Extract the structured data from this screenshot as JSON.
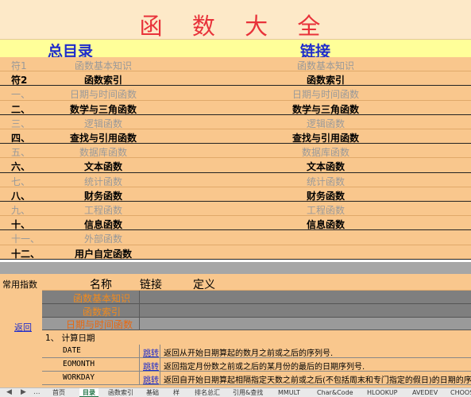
{
  "title": "函 数 大 全",
  "header": {
    "left": "总目录",
    "right": "链接"
  },
  "toc": [
    {
      "num": "符1",
      "label": "函数基本知识",
      "link": "函数基本知识",
      "style": "g"
    },
    {
      "num": "符2",
      "label": "函数索引",
      "link": "函数索引",
      "style": "b"
    },
    {
      "num": "一、",
      "label": "日期与时间函数",
      "link": "日期与时间函数",
      "style": "g"
    },
    {
      "num": "二、",
      "label": "数学与三角函数",
      "link": "数学与三角函数",
      "style": "b"
    },
    {
      "num": "三、",
      "label": "逻辑函数",
      "link": "逻辑函数",
      "style": "g"
    },
    {
      "num": "四、",
      "label": "查找与引用函数",
      "link": "查找与引用函数",
      "style": "b"
    },
    {
      "num": "五、",
      "label": "数据库函数",
      "link": "数据库函数",
      "style": "g"
    },
    {
      "num": "六、",
      "label": "文本函数",
      "link": "文本函数",
      "style": "b"
    },
    {
      "num": "七、",
      "label": "统计函数",
      "link": "统计函数",
      "style": "g"
    },
    {
      "num": "八、",
      "label": "财务函数",
      "link": "财务函数",
      "style": "b"
    },
    {
      "num": "九、",
      "label": "工程函数",
      "link": "工程函数",
      "style": "g"
    },
    {
      "num": "十、",
      "label": "信息函数",
      "link": "信息函数",
      "style": "b"
    },
    {
      "num": "十一、",
      "label": "外部函数",
      "link": "",
      "style": "g"
    },
    {
      "num": "十二、",
      "label": "用户自定函数",
      "link": "",
      "style": "b"
    }
  ],
  "lower": {
    "common_label": "常用指数",
    "back_link": "返回",
    "col_name": "名称",
    "col_link": "链接",
    "col_def": "定义",
    "dark_rows": [
      "函数基本知识",
      "函数索引"
    ],
    "section": "日期与时间函数",
    "subsection": "1、  计算日期",
    "functions": [
      {
        "name": "DATE",
        "jump": "跳转",
        "desc": "返回从开始日期算起的数月之前或之后的序列号."
      },
      {
        "name": "EOMONTH",
        "jump": "跳转",
        "desc": "返回指定月份数之前或之后的某月份的最后的日期序列号."
      },
      {
        "name": "WORKDAY",
        "jump": "跳转",
        "desc": "返回自开始日期算起相隔指定天数之前或之后(不包括周末和专门指定的假日)的日期的序列号."
      }
    ]
  },
  "tabs": {
    "nav": [
      "◀",
      "▶",
      "..."
    ],
    "items": [
      "首页",
      "目录",
      "函数索引",
      "基础",
      "样",
      "排名总汇",
      "引用&查找",
      "MMULT",
      "Char&Code",
      "HLOOKUP",
      "AVEDEV",
      "CHOOSE"
    ],
    "active_index": 1
  }
}
